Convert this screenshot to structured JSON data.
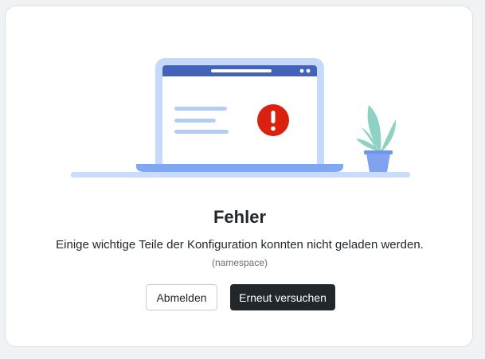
{
  "dialog": {
    "title": "Fehler",
    "message": "Einige wichtige Teile der Konfiguration konnten nicht geladen werden.",
    "detail": "(namespace)"
  },
  "buttons": {
    "logout_label": "Abmelden",
    "retry_label": "Erneut versuchen"
  },
  "illustration": {
    "icons": [
      "laptop-icon",
      "error-icon",
      "plant-icon"
    ],
    "colors": {
      "laptop_frame": "#c4d9fb",
      "laptop_header": "#4263b8",
      "laptop_base": "#7fa7f4",
      "text_lines": "#b5ccf7",
      "error": "#d8210e",
      "plant_leaves": "#8fd1c3",
      "plant_pot": "#7fa3f0",
      "ground": "#c9dcfb"
    }
  },
  "colors": {
    "primary_button": "#22272b",
    "text": "#22272b",
    "muted_text": "#6b6e76"
  }
}
